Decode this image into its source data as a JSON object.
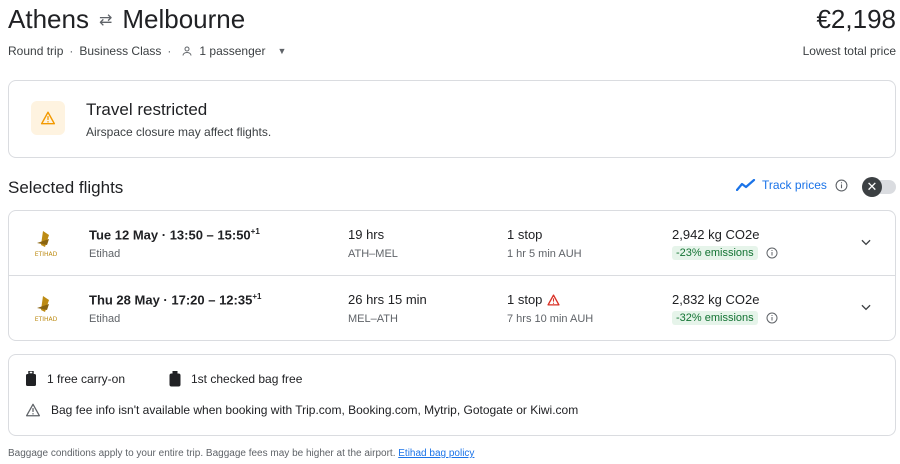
{
  "header": {
    "origin": "Athens",
    "destination": "Melbourne",
    "price": "€2,198",
    "price_note": "Lowest total price",
    "trip_type": "Round trip",
    "cabin": "Business Class",
    "passengers": "1 passenger"
  },
  "alert": {
    "title": "Travel restricted",
    "text": "Airspace closure may affect flights."
  },
  "selected": {
    "title": "Selected flights",
    "track_label": "Track prices"
  },
  "flights": [
    {
      "date": "Tue 12 May",
      "depart": "13:50",
      "arrive": "15:50",
      "day_offset": "+1",
      "airline": "Etihad",
      "duration": "19 hrs",
      "route": "ATH–MEL",
      "stops": "1 stop",
      "layover": "1 hr 5 min AUH",
      "co2": "2,942 kg CO2e",
      "emissions": "-23% emissions"
    },
    {
      "date": "Thu 28 May",
      "depart": "17:20",
      "arrive": "12:35",
      "day_offset": "+1",
      "airline": "Etihad",
      "duration": "26 hrs 15 min",
      "route": "MEL–ATH",
      "stops": "1 stop",
      "layover": "7 hrs 10 min AUH",
      "co2": "2,832 kg CO2e",
      "emissions": "-32% emissions"
    }
  ],
  "baggage": {
    "carry_on": "1 free carry-on",
    "checked": "1st checked bag free",
    "warning": "Bag fee info isn't available when booking with Trip.com, Booking.com, Mytrip, Gotogate or Kiwi.com"
  },
  "footer": {
    "text": "Baggage conditions apply to your entire trip. Baggage fees may be higher at the airport.",
    "link": "Etihad bag policy"
  },
  "colors": {
    "accent": "#1a73e8",
    "warning": "#f29900",
    "alert_red": "#d93025",
    "emissions_bg": "#e6f4ea",
    "emissions_text": "#137333"
  },
  "icons": [
    "swap-arrows-icon",
    "person-icon",
    "dropdown-caret-icon",
    "warning-icon",
    "trend-line-icon",
    "info-icon",
    "close-icon",
    "etihad-logo",
    "chevron-down-icon",
    "carry-on-bag-icon",
    "checked-bag-icon"
  ]
}
